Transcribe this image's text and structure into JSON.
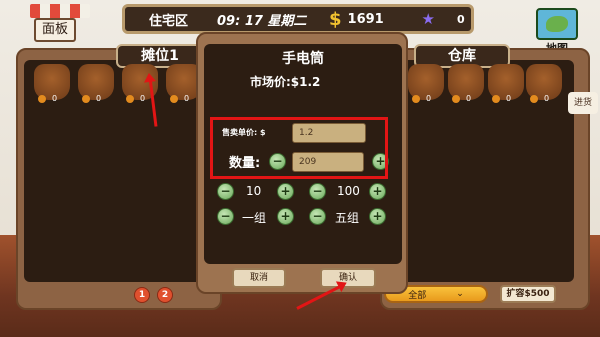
{
  "hud": {
    "location": "住宅区",
    "time": "09: 17 星期二",
    "currency_symbol": "$",
    "money": "1691",
    "gems": "0"
  },
  "panel_button": "面板",
  "map_label": "地图",
  "stall": {
    "tab": "摊位1",
    "slots": [
      {
        "count": "0"
      },
      {
        "count": "0"
      },
      {
        "count": "0"
      },
      {
        "count": "0"
      }
    ],
    "pages": [
      "1",
      "2"
    ]
  },
  "warehouse": {
    "tab": "仓库",
    "slots": [
      {
        "count": "0"
      },
      {
        "count": "0"
      },
      {
        "count": "0"
      },
      {
        "count": "0"
      }
    ],
    "side_button": "进货",
    "filter_value": "全部",
    "expand_button": "扩容$500"
  },
  "dialog": {
    "title": "手电筒",
    "market_price": "市场价:$1.2",
    "unit_price_label": "售卖单价: $",
    "unit_price_value": "1.2",
    "qty_label": "数量:",
    "qty_value": "209",
    "steps": {
      "step1": "10",
      "step2": "100",
      "step3": "一组",
      "step4": "五组"
    },
    "cancel": "取消",
    "confirm": "确认"
  },
  "colors": {
    "highlight": "#e21515",
    "panel": "#8d6344",
    "dark": "#2c1d12"
  },
  "icons": {
    "money": "dollar-sign",
    "gem": "star-gem",
    "plus": "plus-circle",
    "minus": "minus-circle",
    "map": "map-icon"
  }
}
